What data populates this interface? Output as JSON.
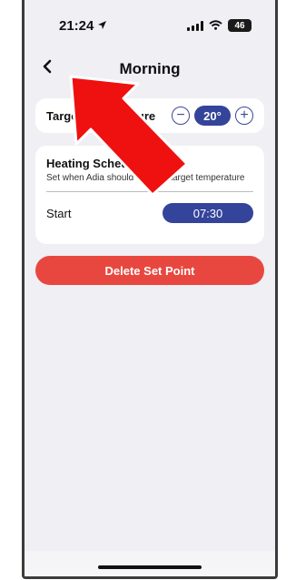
{
  "status_bar": {
    "time": "21:24",
    "battery": "46"
  },
  "header": {
    "title": "Morning"
  },
  "target_temperature": {
    "label": "Target Temperature",
    "value": "20°",
    "minus": "−",
    "plus": "+"
  },
  "heating_schedule": {
    "title": "Heating Schedule",
    "subtitle": "Set when Adia should use this target temperature",
    "start_label": "Start",
    "start_time": "07:30"
  },
  "actions": {
    "delete_label": "Delete Set Point"
  },
  "colors": {
    "accent": "#34449a",
    "danger": "#e8473f",
    "annotation_arrow": "#ef1010"
  },
  "icons": [
    "location-arrow-icon",
    "signal-icon",
    "wifi-icon",
    "battery-icon",
    "chevron-left-icon",
    "annotation-arrow-icon"
  ]
}
